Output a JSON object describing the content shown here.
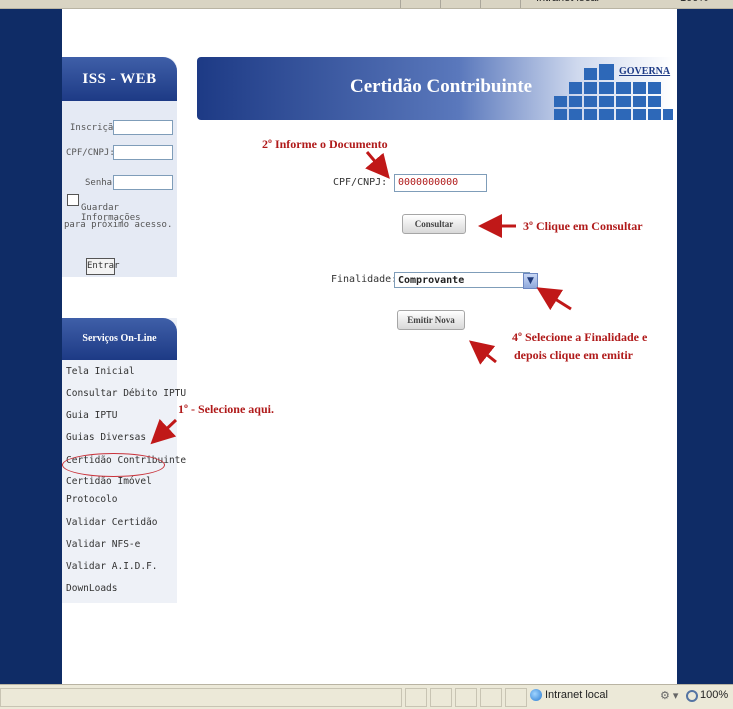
{
  "browser": {
    "zone_label": "Intranet local",
    "zoom_label": "100%"
  },
  "sidebar": {
    "login_title": "ISS - WEB",
    "fields": {
      "inscricao_label": "Inscrição:",
      "cpf_label": "CPF/CNPJ:",
      "senha_label": "Senha:"
    },
    "remember_line1": "Guardar Informações",
    "remember_line2": "para próximo acesso.",
    "login_button": "Entrar",
    "services_title": "Serviços On-Line",
    "services": [
      "Tela Inicial",
      "Consultar Débito IPTU",
      "Guia IPTU",
      "Guias Diversas",
      "Certidão Contribuinte",
      "Certidão Imóvel",
      "Protocolo",
      "Validar Certidão",
      "Validar NFS-e",
      "Validar A.I.D.F.",
      "DownLoads"
    ]
  },
  "banner": {
    "title": "Certidão Contribuinte",
    "logo_text": "GOVERNA"
  },
  "form": {
    "cpf_label": "CPF/CNPJ:",
    "cpf_value": "0000000000",
    "consultar_button": "Consultar",
    "finalidade_label": "Finalidade:",
    "finalidade_selected": "Comprovante",
    "emitir_button": "Emitir Nova"
  },
  "annotations": {
    "step1": "1º - Selecione aqui.",
    "step2": "2º Informe o Documento",
    "step3": "3º Clique em Consultar",
    "step4_line1": "4º Selecione a Finalidade e",
    "step4_line2": "depois clique em emitir"
  },
  "colors": {
    "navy": "#0f2c66",
    "annotation_red": "#b01a1a",
    "accent_blue": "#2d68b8"
  }
}
